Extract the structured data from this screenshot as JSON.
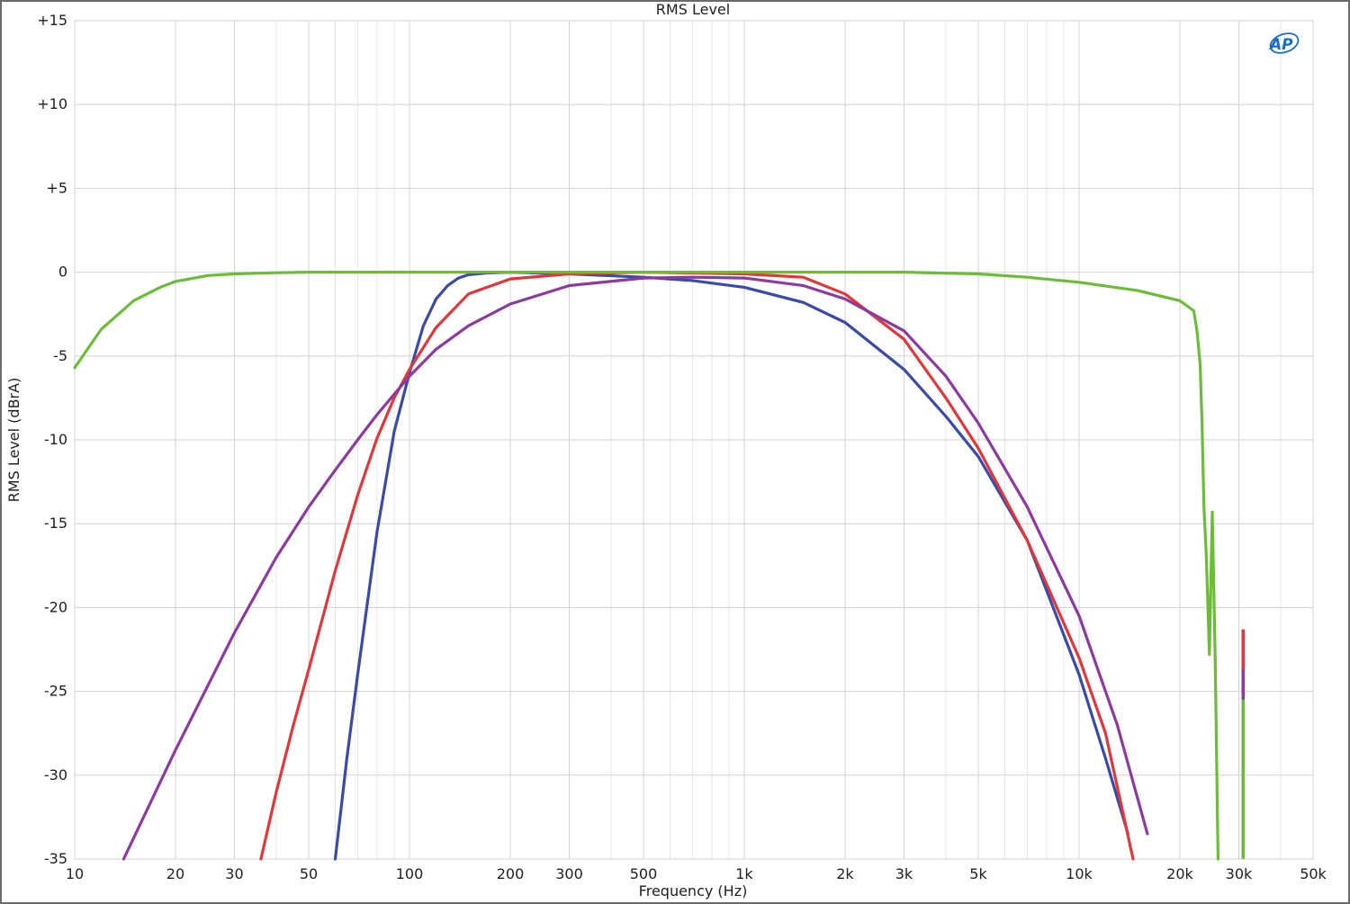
{
  "chart_data": {
    "type": "line",
    "title": "RMS Level",
    "xlabel": "Frequency (Hz)",
    "ylabel": "RMS Level (dBrA)",
    "x_scale": "log",
    "xlim": [
      10,
      50000
    ],
    "ylim": [
      -35,
      15
    ],
    "grid": true,
    "legend": "none",
    "logo_text": "AP",
    "y_ticks": [
      {
        "value": 15,
        "label": "+15"
      },
      {
        "value": 10,
        "label": "+10"
      },
      {
        "value": 5,
        "label": "+5"
      },
      {
        "value": 0,
        "label": "0"
      },
      {
        "value": -5,
        "label": "-5"
      },
      {
        "value": -10,
        "label": "-10"
      },
      {
        "value": -15,
        "label": "-15"
      },
      {
        "value": -20,
        "label": "-20"
      },
      {
        "value": -25,
        "label": "-25"
      },
      {
        "value": -30,
        "label": "-30"
      },
      {
        "value": -35,
        "label": "-35"
      }
    ],
    "x_ticks": [
      {
        "value": 10,
        "label": "10"
      },
      {
        "value": 20,
        "label": "20"
      },
      {
        "value": 30,
        "label": "30"
      },
      {
        "value": 50,
        "label": "50"
      },
      {
        "value": 100,
        "label": "100"
      },
      {
        "value": 200,
        "label": "200"
      },
      {
        "value": 300,
        "label": "300"
      },
      {
        "value": 500,
        "label": "500"
      },
      {
        "value": 1000,
        "label": "1k"
      },
      {
        "value": 2000,
        "label": "2k"
      },
      {
        "value": 3000,
        "label": "3k"
      },
      {
        "value": 5000,
        "label": "5k"
      },
      {
        "value": 10000,
        "label": "10k"
      },
      {
        "value": 20000,
        "label": "20k"
      },
      {
        "value": 30000,
        "label": "30k"
      },
      {
        "value": 50000,
        "label": "50k"
      }
    ],
    "series": [
      {
        "color": "#3a4aa8",
        "x": [
          60,
          65,
          70,
          80,
          90,
          100,
          110,
          120,
          130,
          140,
          150,
          170,
          200,
          300,
          500,
          700,
          1000,
          1500,
          2000,
          3000,
          4000,
          5000,
          7000,
          10000,
          12000,
          14000
        ],
        "y": [
          -35,
          -29,
          -24,
          -15.5,
          -9.5,
          -6,
          -3.2,
          -1.6,
          -0.8,
          -0.35,
          -0.15,
          -0.05,
          0,
          -0.1,
          -0.3,
          -0.5,
          -0.9,
          -1.8,
          -3,
          -5.8,
          -8.6,
          -11,
          -16,
          -24,
          -29,
          -33.5
        ]
      },
      {
        "color": "#e0383a",
        "x": [
          36,
          40,
          45,
          50,
          60,
          70,
          80,
          90,
          100,
          120,
          150,
          200,
          300,
          500,
          1000,
          1500,
          2000,
          3000,
          4000,
          5000,
          7000,
          10000,
          12000,
          14500
        ],
        "y": [
          -35,
          -31,
          -27,
          -23.7,
          -17.8,
          -13.3,
          -9.9,
          -7.5,
          -5.8,
          -3.3,
          -1.3,
          -0.4,
          -0.1,
          0,
          -0.1,
          -0.3,
          -1.3,
          -4,
          -7.5,
          -10.5,
          -16,
          -23,
          -27.5,
          -35
        ]
      },
      {
        "color": "#8c3aa0",
        "x": [
          14,
          20,
          30,
          40,
          50,
          60,
          70,
          80,
          100,
          120,
          150,
          200,
          300,
          500,
          700,
          1000,
          1500,
          2000,
          3000,
          4000,
          5000,
          7000,
          10000,
          13000,
          16000
        ],
        "y": [
          -35,
          -28.5,
          -21.5,
          -17,
          -14,
          -11.8,
          -10,
          -8.5,
          -6.2,
          -4.6,
          -3.2,
          -1.9,
          -0.8,
          -0.35,
          -0.3,
          -0.35,
          -0.8,
          -1.6,
          -3.5,
          -6.2,
          -9,
          -14,
          -20.5,
          -27,
          -33.5
        ]
      },
      {
        "color": "#6cbc3a",
        "x": [
          10,
          12,
          15,
          18,
          20,
          25,
          30,
          40,
          50,
          100,
          1000,
          3000,
          5000,
          7000,
          10000,
          15000,
          20000,
          22000,
          22500,
          23000,
          23300,
          23600,
          24000,
          24500,
          25000,
          25500,
          26000
        ],
        "y": [
          -5.7,
          -3.4,
          -1.7,
          -0.9,
          -0.55,
          -0.2,
          -0.1,
          -0.03,
          0,
          0,
          0,
          0,
          -0.1,
          -0.3,
          -0.6,
          -1.1,
          -1.7,
          -2.3,
          -3.5,
          -5.5,
          -9,
          -14,
          -17,
          -22.8,
          -14.3,
          -23,
          -35
        ]
      }
    ],
    "spikes": [
      {
        "x": 30900,
        "color": "#e0383a",
        "y_top": -21.3,
        "y_bottom": -35
      },
      {
        "x": 30900,
        "color": "#8c3aa0",
        "y_top": -23.7,
        "y_bottom": -35
      },
      {
        "x": 30900,
        "color": "#6cbc3a",
        "y_top": -25.5,
        "y_bottom": -35
      }
    ]
  }
}
